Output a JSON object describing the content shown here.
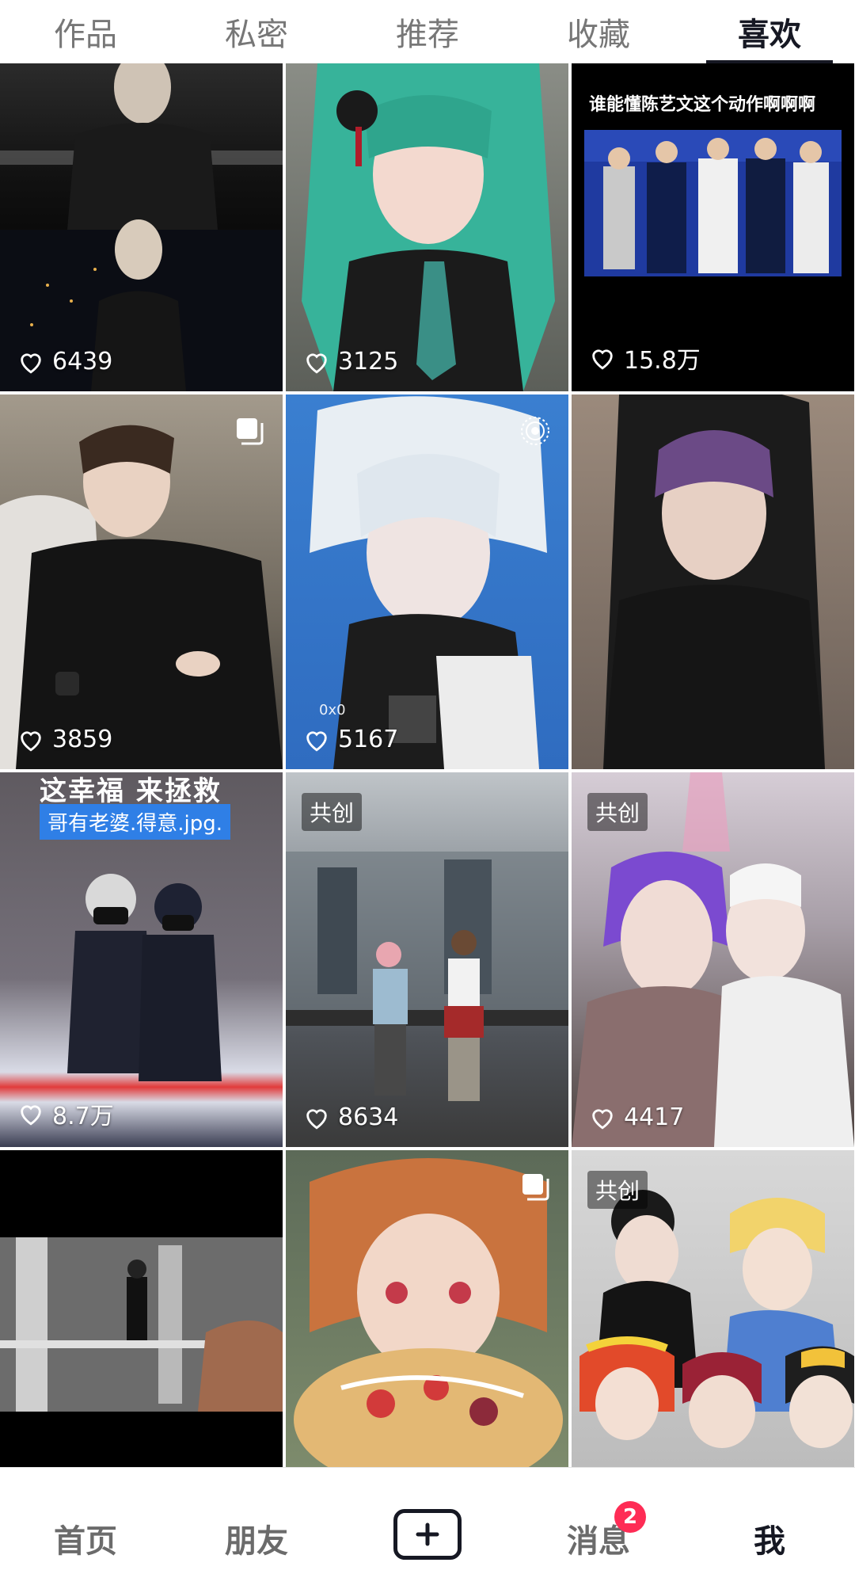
{
  "tabs": [
    {
      "label": "作品"
    },
    {
      "label": "私密"
    },
    {
      "label": "推荐"
    },
    {
      "label": "收藏"
    },
    {
      "label": "喜欢"
    }
  ],
  "active_tab_index": 4,
  "grid": {
    "items": [
      {
        "likes": "6439",
        "badge": ""
      },
      {
        "likes": "3125",
        "badge": ""
      },
      {
        "likes": "15.8万",
        "caption": "谁能懂陈艺文这个动作啊啊啊"
      },
      {
        "likes": "3859",
        "corner_icon": "multi-image-icon"
      },
      {
        "likes": "5167",
        "corner_icon": "live-photo-icon",
        "overlay_text": "0x0"
      },
      {
        "likes": ""
      },
      {
        "likes": "8.7万",
        "top_caption": "这幸福 来拯救",
        "tag": "哥有老婆.得意.jpg."
      },
      {
        "likes": "8634",
        "badge": "共创"
      },
      {
        "likes": "4417",
        "badge": "共创"
      },
      {
        "likes": ""
      },
      {
        "likes": "",
        "corner_icon": "multi-image-icon"
      },
      {
        "likes": "",
        "badge": "共创"
      }
    ]
  },
  "bottom_nav": {
    "home": "首页",
    "friends": "朋友",
    "add_icon": "plus-icon",
    "messages": "消息",
    "messages_badge": "2",
    "me": "我"
  },
  "colors": {
    "accent": "#fe2c55",
    "text_primary": "#161823",
    "text_secondary": "#777777"
  }
}
